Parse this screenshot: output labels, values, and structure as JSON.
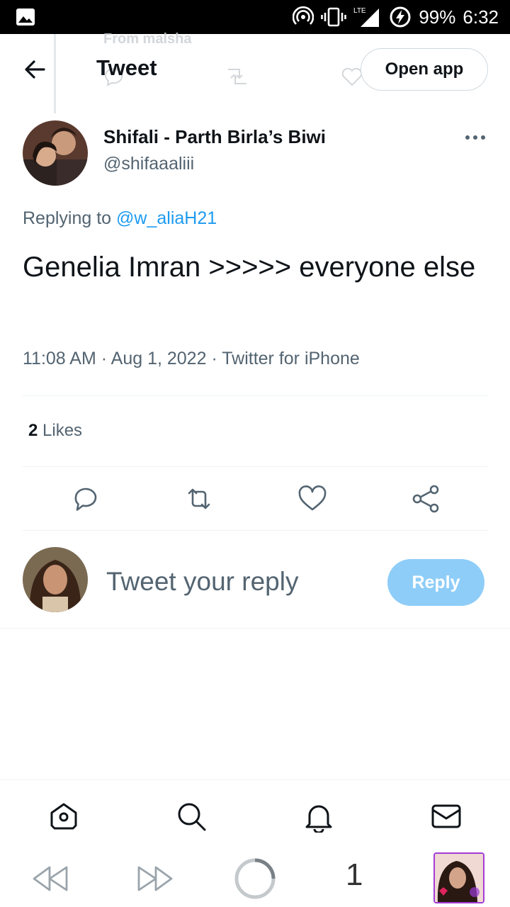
{
  "status_bar": {
    "battery": "99%",
    "time": "6:32",
    "network": "LTE",
    "icons": [
      "gallery-icon",
      "hotspot-icon",
      "vibrate-icon",
      "signal-icon",
      "battery-charging-icon"
    ]
  },
  "header": {
    "title": "Tweet",
    "open_app_label": "Open app",
    "ghost_text": "From malsha"
  },
  "tweet": {
    "author_name": "Shifali - Parth Birla’s Biwi",
    "author_handle": "@shifaaaliii",
    "replying_prefix": "Replying to",
    "replying_mention": "@w_aliaH21",
    "text": "Genelia Imran >>>>> everyone else",
    "time": "11:08 AM",
    "date": "Aug 1, 2022",
    "source": "Twitter for iPhone",
    "likes_count": "2",
    "likes_label": "Likes"
  },
  "composer": {
    "placeholder": "Tweet your reply",
    "reply_label": "Reply"
  },
  "tabbar": {
    "items": [
      "home",
      "search",
      "notifications",
      "messages"
    ]
  },
  "browser": {
    "tab_count": "1"
  },
  "colors": {
    "accent": "#1d9bf0",
    "reply_button_disabled": "#8ecdf8",
    "secondary_text": "#536471",
    "primary_text": "#0f1419",
    "browser_avatar_border": "#a43bd6"
  }
}
